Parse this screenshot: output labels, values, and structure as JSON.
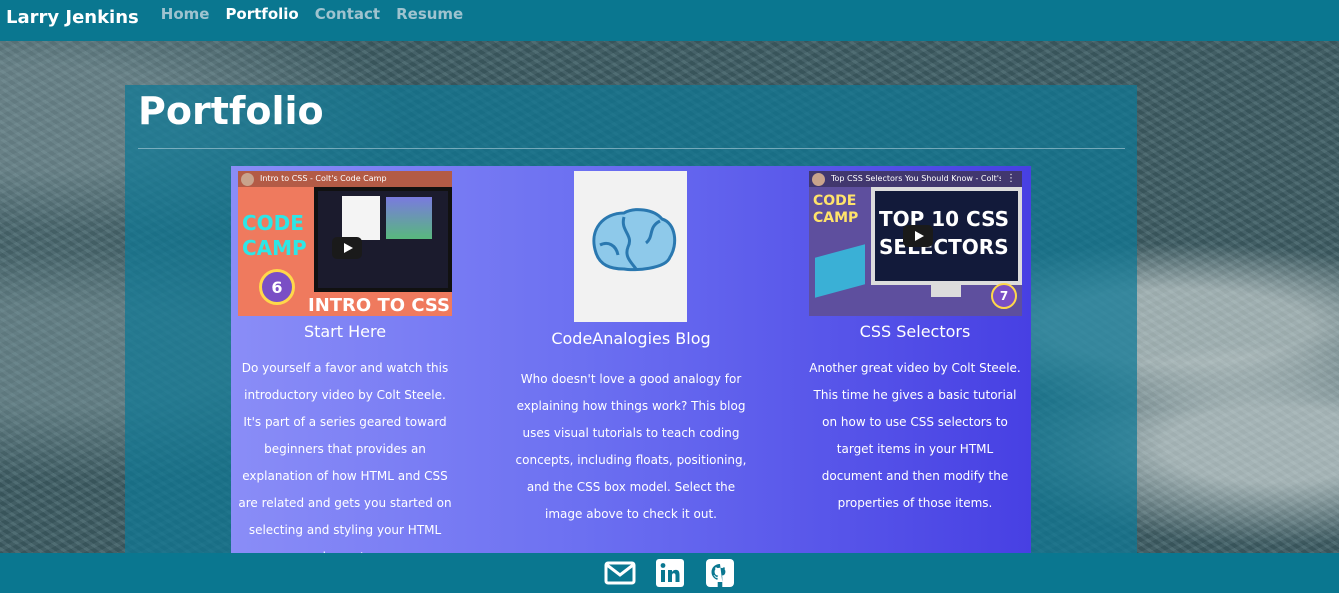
{
  "nav": {
    "brand": "Larry Jenkins",
    "links": [
      "Home",
      "Portfolio",
      "Contact",
      "Resume"
    ],
    "active": "Portfolio"
  },
  "page": {
    "title": "Portfolio"
  },
  "cards": [
    {
      "title": "Start Here",
      "description": "Do yourself a favor and watch this introductory video by Colt Steele. It's part of a series geared toward beginners that provides an explanation of how HTML and CSS are related and gets you started on selecting and styling your HTML elements.",
      "thumbnail": {
        "video_title": "Intro to CSS - Colt's Code Camp",
        "badge_lines": [
          "CODE",
          "CAMP"
        ],
        "episode": "6",
        "caption": "INTRO TO CSS"
      }
    },
    {
      "title": "CodeAnalogies Blog",
      "description": "Who doesn't love a good analogy for explaining how things work? This blog uses visual tutorials to teach coding concepts, including floats, positioning, and the CSS box model. Select the image above to check it out.",
      "thumbnail": {
        "icon": "brain-logo-icon"
      }
    },
    {
      "title": "CSS Selectors",
      "description": "Another great video by Colt Steele. This time he gives a basic tutorial on how to use CSS selectors to target items in your HTML document and then modify the properties of those items.",
      "thumbnail": {
        "video_title": "Top CSS Selectors You Should Know - Colt's ...",
        "badge_lines": [
          "CODE",
          "CAMP"
        ],
        "episode": "7",
        "headline_lines": [
          "TOP 10 CSS",
          "SELECTORS"
        ]
      }
    }
  ],
  "footer": {
    "icons": [
      "envelope-icon",
      "linkedin-icon",
      "github-icon"
    ]
  },
  "colors": {
    "nav": "#0a7790",
    "panel": "#0e7896",
    "card_gradient_start": "#8a8df7",
    "card_gradient_end": "#4740e3"
  }
}
